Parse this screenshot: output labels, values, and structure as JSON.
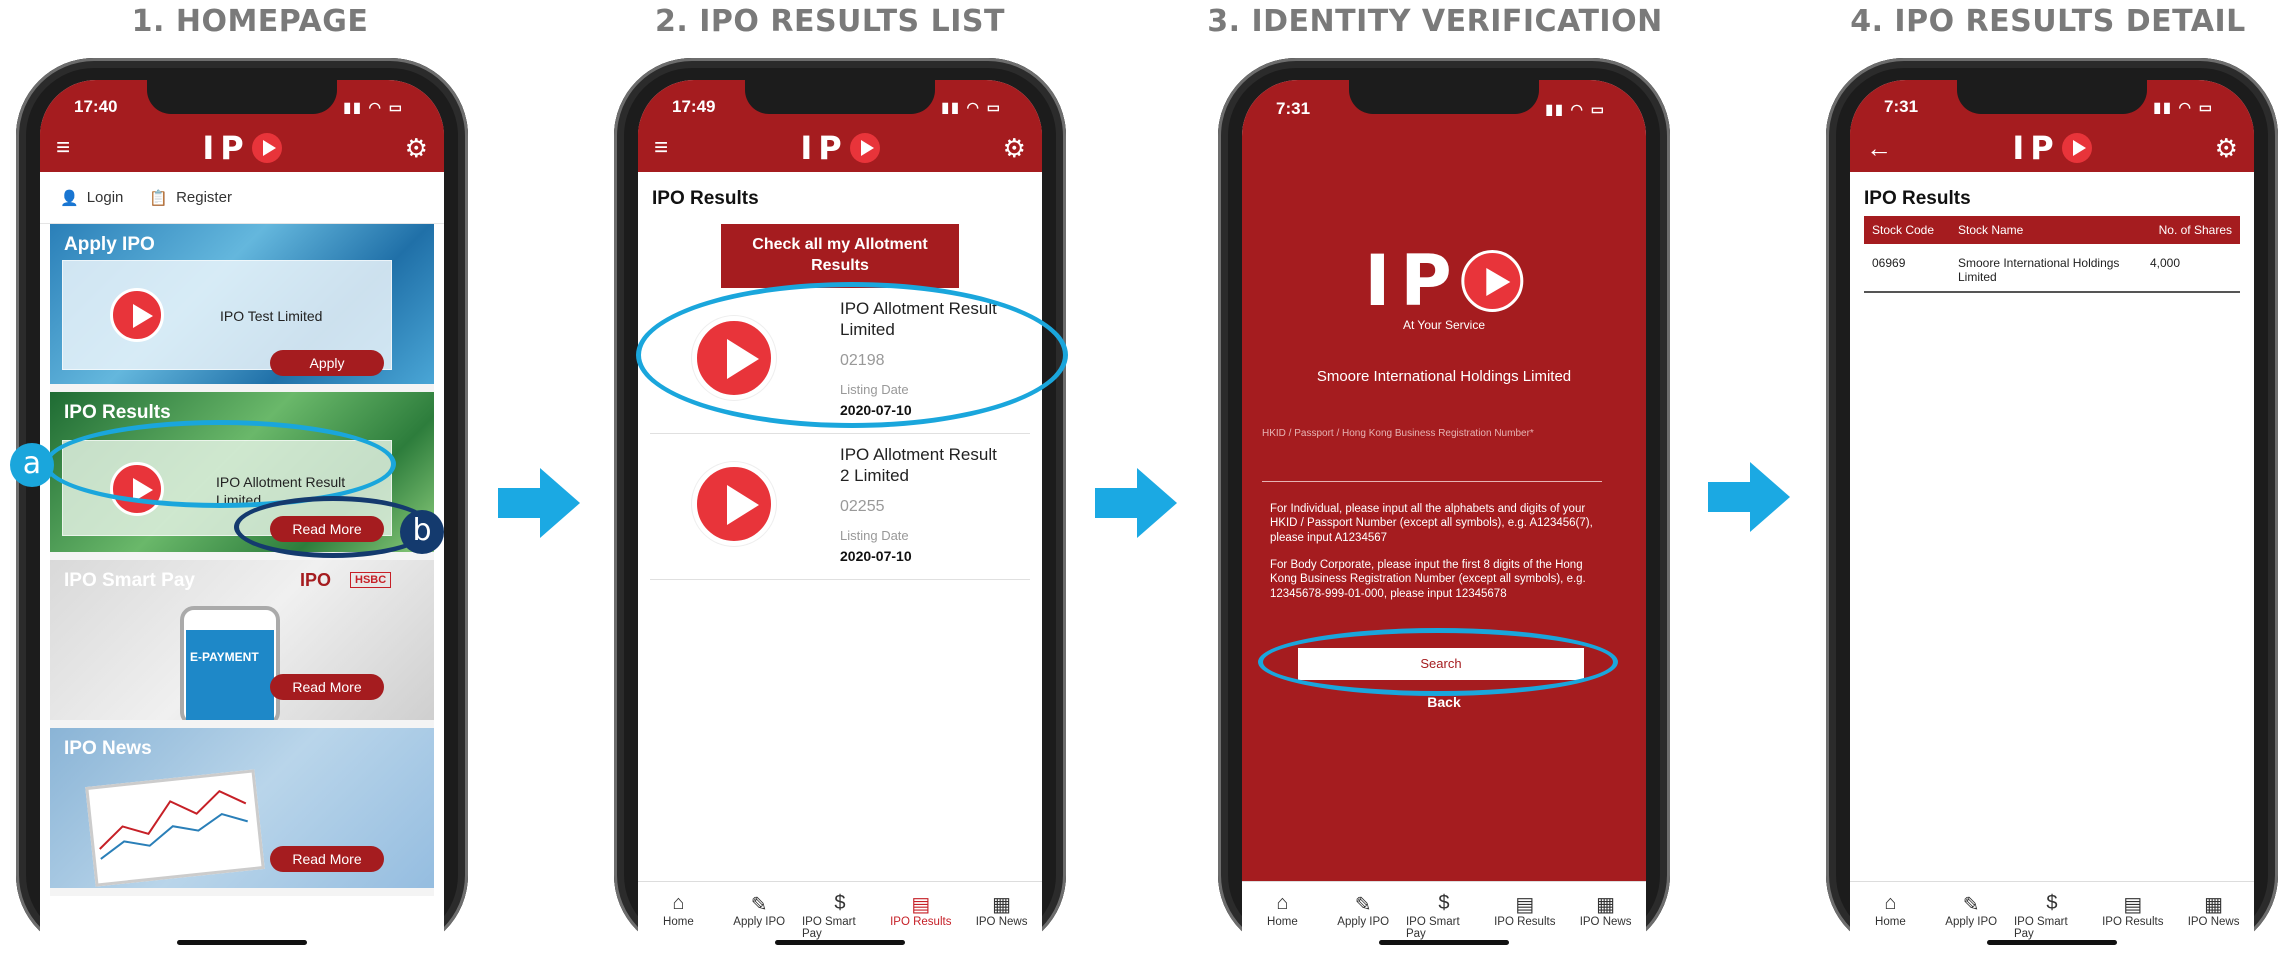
{
  "steps": [
    {
      "title": "1. HOMEPAGE"
    },
    {
      "title": "2. IPO RESULTS LIST"
    },
    {
      "title": "3. IDENTITY VERIFICATION"
    },
    {
      "title": "4. IPO RESULTS DETAIL"
    }
  ],
  "phone1": {
    "time": "17:40",
    "logo": "IP",
    "login": "Login",
    "register": "Register",
    "cards": {
      "apply": {
        "title": "Apply IPO",
        "text": "IPO Test Limited",
        "button": "Apply"
      },
      "results": {
        "title": "IPO Results",
        "text": "IPO Allotment Result Limited",
        "button": "Read More"
      },
      "smartpay": {
        "title": "IPO Smart Pay",
        "brand": "IPO",
        "badge": "HSBC",
        "button": "Read More",
        "phone_text": "E-PAYMENT"
      },
      "news": {
        "title": "IPO News",
        "button": "Read More"
      }
    },
    "annotation_a": "a",
    "annotation_b": "b"
  },
  "phone2": {
    "time": "17:49",
    "logo": "IP",
    "section_title": "IPO Results",
    "check_button": "Check all my Allotment Results",
    "results": [
      {
        "name": "IPO Allotment Result Limited",
        "code": "02198",
        "listing_label": "Listing Date",
        "date": "2020-07-10"
      },
      {
        "name": "IPO Allotment Result 2 Limited",
        "code": "02255",
        "listing_label": "Listing Date",
        "date": "2020-07-10"
      }
    ]
  },
  "phone3": {
    "time": "7:31",
    "logo": "IP",
    "tagline": "At Your Service",
    "company": "Smoore International Holdings Limited",
    "field_label": "HKID / Passport / Hong Kong Business Registration Number*",
    "instruction_individual": "For Individual, please input all the alphabets and digits of your HKID / Passport Number (except all symbols), e.g. A123456(7), please input A1234567",
    "instruction_corporate": "For Body Corporate, please input the first 8 digits of the Hong Kong Business Registration Number (except all symbols), e.g. 12345678-999-01-000, please input 12345678",
    "search_button": "Search",
    "back_button": "Back"
  },
  "phone4": {
    "time": "7:31",
    "logo": "IP",
    "section_title": "IPO Results",
    "columns": [
      "Stock Code",
      "Stock Name",
      "No. of Shares"
    ],
    "rows": [
      {
        "code": "06969",
        "name": "Smoore International Holdings Limited",
        "shares": "4,000"
      }
    ]
  },
  "tabbar": [
    {
      "icon": "home-icon",
      "label": "Home"
    },
    {
      "icon": "pencil-icon",
      "label": "Apply IPO"
    },
    {
      "icon": "dollar-icon",
      "label": "IPO Smart Pay"
    },
    {
      "icon": "clipboard-icon",
      "label": "IPO Results"
    },
    {
      "icon": "newspaper-icon",
      "label": "IPO News"
    }
  ],
  "colors": {
    "brand_red": "#a51c1f",
    "accent_red": "#e8343a",
    "annotation_blue": "#1aa6dc",
    "annotation_navy": "#143a6e",
    "arrow_blue": "#1ba9e3"
  }
}
